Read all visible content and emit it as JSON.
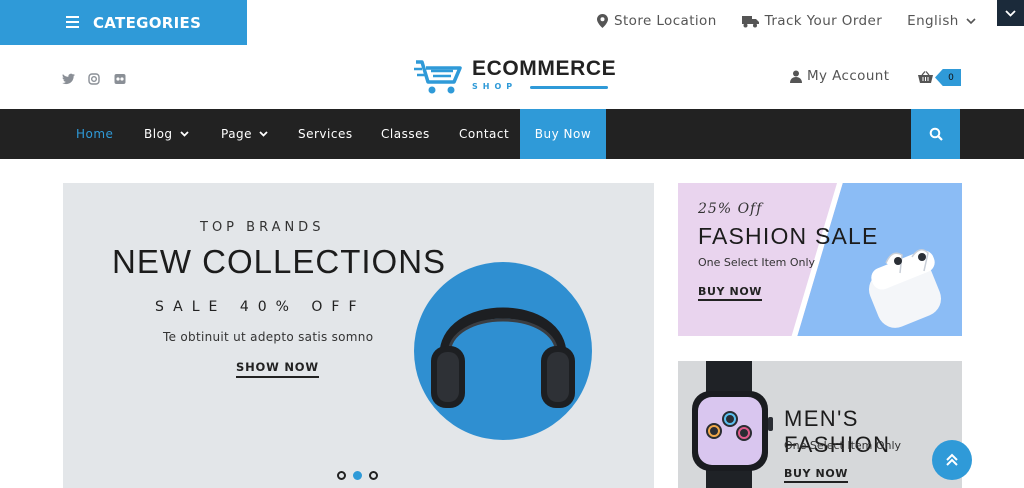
{
  "topbar": {
    "categories_label": "CATEGORIES",
    "store_location": "Store Location",
    "track_order": "Track Your Order",
    "language": "English"
  },
  "header": {
    "brand": "ECOMMERCE",
    "brand_sub": "SHOP",
    "account": "My Account",
    "cart_count": "0",
    "social_icons": [
      "twitter-icon",
      "instagram-icon",
      "flickr-icon"
    ]
  },
  "nav": {
    "items": [
      {
        "label": "Home",
        "active": true
      },
      {
        "label": "Blog",
        "dropdown": true
      },
      {
        "label": "Page",
        "dropdown": true
      },
      {
        "label": "Services"
      },
      {
        "label": "Classes"
      },
      {
        "label": "Contact"
      },
      {
        "label": "Buy Now"
      }
    ]
  },
  "hero": {
    "eyebrow": "TOP BRANDS",
    "title": "NEW COLLECTIONS",
    "sale": "SALE 40% OFF",
    "description": "Te obtinuit ut adepto satis somno",
    "cta": "SHOW NOW",
    "slide_count": 3,
    "active_slide": 2
  },
  "promo_fashion": {
    "discount": "25% Off",
    "title": "FASHION SALE",
    "subtitle": "One Select Item Only",
    "cta": "BUY NOW"
  },
  "promo_men": {
    "title": "MEN'S FASHION",
    "subtitle": "One Select Item Only",
    "cta": "BUY NOW"
  },
  "colors": {
    "accent": "#2f9ad8",
    "nav_bg": "#222222",
    "hero_bg": "#e3e6e9",
    "promo_pink": "#e9d4ee",
    "promo_blue": "#8bbcf5"
  }
}
